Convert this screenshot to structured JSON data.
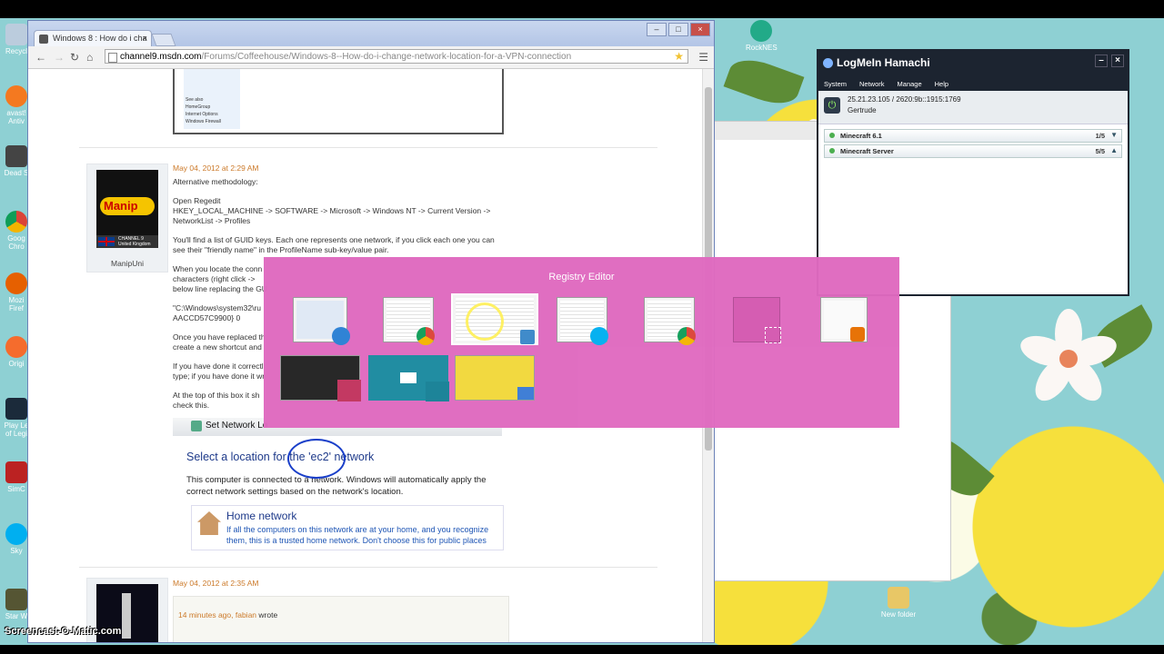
{
  "browser": {
    "tab_title": "Windows 8 : How do i cha",
    "tab_close": "×",
    "url_host": "channel9.msdn.com",
    "url_path": "/Forums/Coffeehouse/Windows-8--How-do-i-change-network-location-for-a-VPN-connection",
    "window_buttons": [
      "–",
      "□",
      "×"
    ]
  },
  "screenshot_top": {
    "items": [
      "See also",
      "HomeGroup",
      "Internet Options",
      "Windows Firewall"
    ]
  },
  "post1": {
    "author": "ManipUni",
    "avatar_text": "Manip",
    "avatar_badge": "CHANNEL 9",
    "avatar_country": "United Kingdom",
    "date": "May 04, 2012 at 2:29 AM",
    "line1": "Alternative methodology:",
    "line2": "Open Regedit",
    "line3": "HKEY_LOCAL_MACHINE -> SOFTWARE -> Microsoft -> Windows NT -> Current Version -> NetworkList -> Profiles",
    "line4": "You'll find a list of GUID keys. Each one represents one network, if you click each one you can see their \"friendly name\" in the ProfileName sub-key/value pair.",
    "line5a": "When you locate the conn",
    "line5b": "characters (right click ->",
    "line5c": "below line replacing the GU",
    "line6a": "\"C:\\Windows\\system32\\ru",
    "line6b": "AACCD57C9900} 0",
    "line7a": "Once you have replaced th",
    "line7b": "create a new shortcut and",
    "line8a": "If you have done it correctl",
    "line8b": "type; if you have done it wr",
    "line9a": "At the top of this box it sh",
    "line9b": "check this."
  },
  "set_network": {
    "bar_title": "Set Network Lo",
    "heading": "Select a location for the 'ec2' network",
    "body": "This computer is connected to a network. Windows will automatically apply the correct network settings based on the network's location.",
    "home_title": "Home network",
    "home_desc": "If all the computers on this network are at your home, and you recognize them, this is a trusted home network.  Don't choose this for public places"
  },
  "post2": {
    "date": "May 04, 2012 at 2:35 AM",
    "quote_time": "14 minutes ago,",
    "quote_user": "fabian",
    "quote_suffix": "wrote"
  },
  "hamachi": {
    "title": "LogMeIn Hamachi",
    "menu": [
      "System",
      "Network",
      "Manage",
      "Help"
    ],
    "ip": "25.21.23.105 / 2620:9b::1915:1769",
    "user": "Gertrude",
    "networks": [
      {
        "name": "Minecraft 6.1",
        "count": "1/5",
        "arrow": "▼"
      },
      {
        "name": "Minecraft Server",
        "count": "5/5",
        "arrow": "▲"
      }
    ],
    "window_buttons": [
      "–",
      "×"
    ]
  },
  "switcher": {
    "title": "Registry Editor"
  },
  "desktop": {
    "icons_left": [
      "Recycl",
      "avast! Antiv",
      "Dead S",
      "Goog Chro",
      "Mozi Firef",
      "Origi",
      "Play Le of Legi",
      "SimC",
      "Sky",
      "Star W"
    ],
    "icon_rocknes": "RockNES",
    "icon_newfolder": "New folder",
    "watermark": "Screencast-O-Matic.com"
  },
  "colors": {
    "switcher_bg": "#e06ac0",
    "hamachi_header": "#1c2430",
    "link_blue": "#1e3a8a",
    "date_orange": "#cc7a2a"
  }
}
